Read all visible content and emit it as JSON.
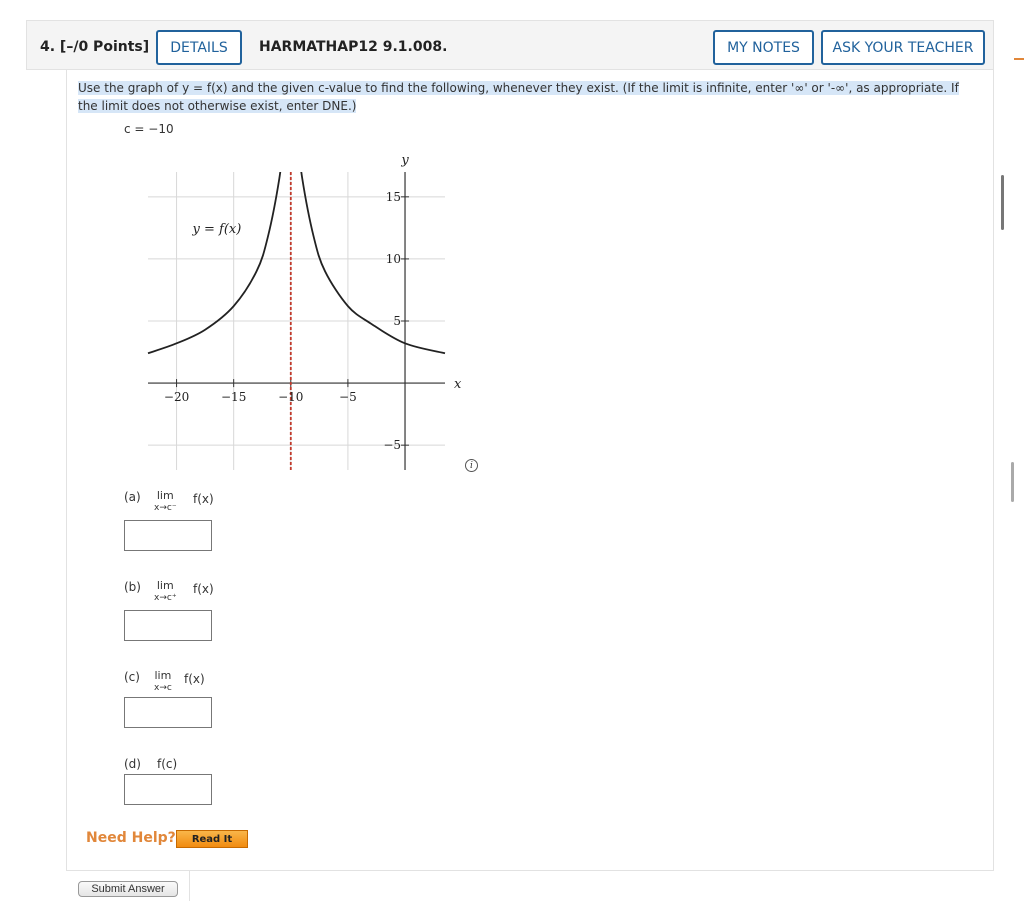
{
  "question": {
    "number_label": "4. [–/0 Points]",
    "details_label": "DETAILS",
    "code": "HARMATHAP12 9.1.008.",
    "my_notes_label": "MY NOTES",
    "ask_teacher_label": "ASK YOUR TEACHER"
  },
  "instructions": "Use the graph of y = f(x) and the given c-value to find the following, whenever they exist. (If the limit is infinite, enter '∞' or '-∞', as appropriate. If the limit does not otherwise exist, enter DNE.)",
  "c_value": "c = −10",
  "chart_data": {
    "type": "line",
    "curve_label": "y = f(x)",
    "xlabel": "x",
    "ylabel": "y",
    "xlim": [
      -22.5,
      3.5
    ],
    "ylim": [
      -7,
      17
    ],
    "x_ticks": [
      "−20",
      "−15",
      "−10",
      "−5"
    ],
    "y_ticks": [
      "15",
      "10",
      "5",
      "−5"
    ],
    "asymptote": {
      "x": -10,
      "style": "dashed",
      "color": "#c0392b"
    },
    "grid": true,
    "series": [
      {
        "name": "left branch",
        "x": [
          -22.5,
          -20,
          -17.5,
          -15,
          -13,
          -12,
          -11,
          -10.5
        ],
        "y": [
          2.4,
          3.2,
          4.3,
          6.2,
          9.0,
          11.8,
          16.5,
          20.5
        ]
      },
      {
        "name": "right branch",
        "x": [
          -9.5,
          -9,
          -8,
          -7,
          -5,
          -3,
          0,
          3.5
        ],
        "y": [
          20.5,
          16.5,
          11.8,
          9.0,
          6.2,
          4.8,
          3.2,
          2.4
        ]
      }
    ]
  },
  "parts": [
    {
      "label": "(a)",
      "lim": "lim",
      "sub": "x→c⁻",
      "fx": "f(x)"
    },
    {
      "label": "(b)",
      "lim": "lim",
      "sub": "x→c⁺",
      "fx": "f(x)"
    },
    {
      "label": "(c)",
      "lim": "lim",
      "sub": "x→c",
      "fx": "f(x)"
    },
    {
      "label": "(d)",
      "fx": "f(c)"
    }
  ],
  "help": {
    "need_help": "Need Help?",
    "read_it": "Read It"
  },
  "submit_label": "Submit Answer",
  "icons": {
    "info": "info-icon"
  },
  "colors": {
    "accent": "#21629c",
    "help": "#e1873a",
    "highlight": "#d6e6f7",
    "asymptote": "#c0392b"
  }
}
